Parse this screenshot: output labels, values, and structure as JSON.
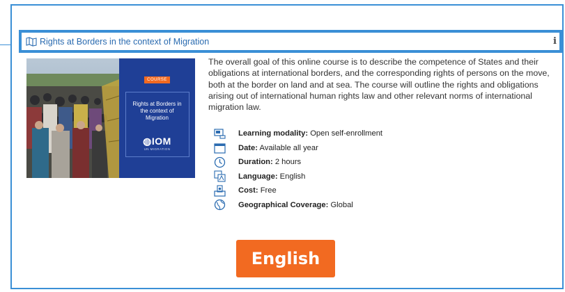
{
  "course": {
    "title": "Rights at Borders in the context of Migration",
    "description": "The overall goal of this online course is to describe the competence of States and their obligations at international borders, and the corresponding rights of persons on the move, both at the border on land and at sea. The course will outline the rights and obligations arising out of international human rights law and other relevant norms of international migration law.",
    "cover": {
      "badge": "COURSE",
      "title": "Rights at Borders in the context of Migration",
      "logo": "IOM",
      "logo_sub": "UN MIGRATION"
    },
    "details": [
      {
        "icon": "learning-modality-icon",
        "label": "Learning modality:",
        "value": "Open self-enrollment"
      },
      {
        "icon": "calendar-icon",
        "label": "Date:",
        "value": "Available all year"
      },
      {
        "icon": "clock-icon",
        "label": "Duration:",
        "value": "2 hours"
      },
      {
        "icon": "language-icon",
        "label": "Language:",
        "value": "English"
      },
      {
        "icon": "cost-icon",
        "label": "Cost:",
        "value": "Free"
      },
      {
        "icon": "globe-icon",
        "label": "Geographical Coverage:",
        "value": "Global"
      }
    ],
    "language_button": "English"
  },
  "colors": {
    "accent_blue": "#3a8fd6",
    "link_blue": "#2a6bb0",
    "orange": "#f26a21",
    "cover_blue": "#1f3f96"
  }
}
